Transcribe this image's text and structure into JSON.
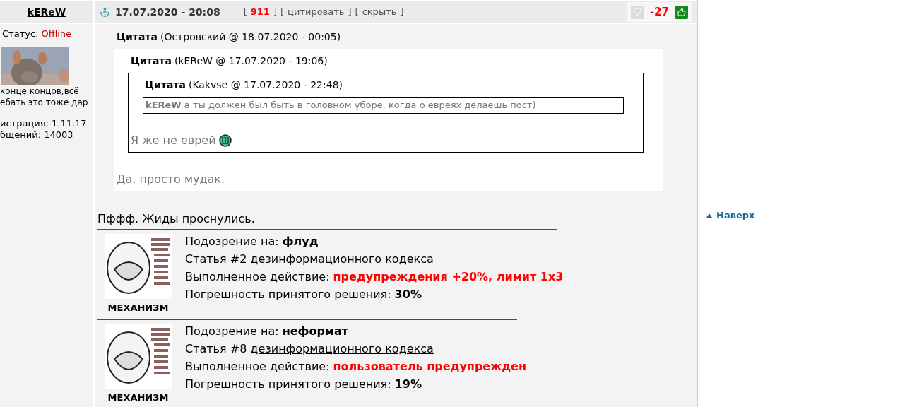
{
  "user": {
    "name": "kEReW",
    "status_label": "Статус:",
    "status": "Offline",
    "signature": [
      "конце концов,всё",
      "ебать это тоже дар"
    ],
    "registration": "истрация: 1.11.17",
    "posts": "бщений: 14003"
  },
  "post": {
    "date": "17.07.2020 - 20:08",
    "links": [
      {
        "text": "911",
        "kind": "count",
        "open": "[",
        "close": "]"
      },
      {
        "text": "цитировать",
        "kind": "link",
        "open": "[",
        "close": "]"
      },
      {
        "text": "скрыть",
        "kind": "link",
        "open": "[",
        "close": "]"
      }
    ],
    "rating": "-27",
    "quote": {
      "label": "Цитата",
      "meta": "(Островский @ 18.07.2020 - 00:05)",
      "text": "Да, просто мудак.",
      "smiley": false,
      "quote": {
        "label": "Цитата",
        "meta": "(kEReW @ 17.07.2020 - 19:06)",
        "text": "Я же не еврей",
        "smiley": true,
        "quote": {
          "label": "Цитата",
          "meta": "(Kakvse @ 17.07.2020 - 22:48)",
          "text": "**kEReW** а ты должен был быть в головном уборе, когда о евреях делаешь пост)",
          "smiley": false
        }
      }
    },
    "body": "Пффф. Жиды проснулись.",
    "verdicts": [
      {
        "suspicion_label": "Подозрение на:",
        "suspicion": "флуд",
        "article": "Статья #2",
        "article_link": "дезинформационного кодекса",
        "action_label": "Выполненное действие:",
        "action": "предупреждения +20%, лимит 1x3",
        "error_label": "Погрешность принятого решения:",
        "error": "30%",
        "mechanism": "МЕХАНИЗМ"
      },
      {
        "suspicion_label": "Подозрение на:",
        "suspicion": "неформат",
        "article": "Статья #8",
        "article_link": "дезинформационного кодекса",
        "action_label": "Выполненное действие:",
        "action": "пользователь предупрежден",
        "error_label": "Погрешность принятого решения:",
        "error": "19%",
        "mechanism": "МЕХАНИЗМ"
      }
    ]
  },
  "back_to_top": "Наверх"
}
